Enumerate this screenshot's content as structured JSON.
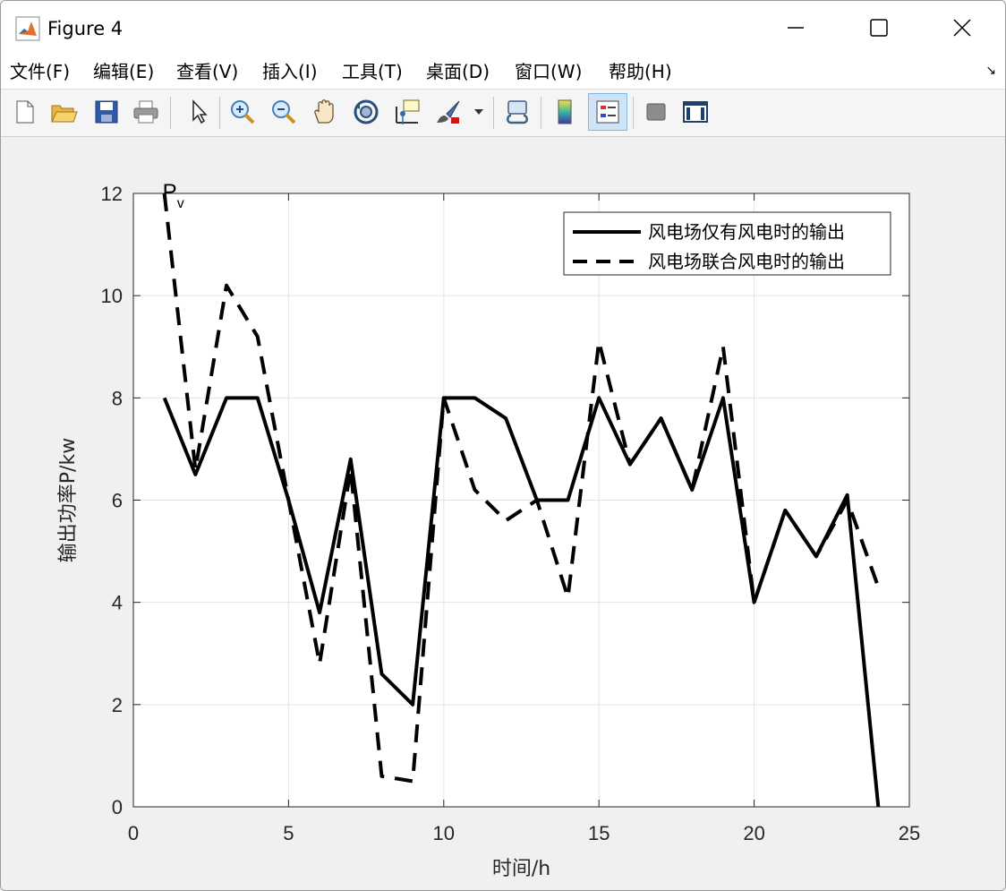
{
  "window": {
    "title": "Figure 4",
    "controls": {
      "minimize_icon": "minimize-icon",
      "maximize_icon": "maximize-icon",
      "close_icon": "close-icon"
    }
  },
  "menubar": {
    "items": [
      "文件(F)",
      "编辑(E)",
      "查看(V)",
      "插入(I)",
      "工具(T)",
      "桌面(D)",
      "窗口(W)",
      "帮助(H)"
    ],
    "more_glyph": "↘"
  },
  "toolbar": {
    "buttons": [
      "new-figure-icon",
      "open-file-icon",
      "save-icon",
      "print-icon",
      "pointer-icon",
      "zoom-in-icon",
      "zoom-out-icon",
      "pan-hand-icon",
      "rotate-3d-icon",
      "data-cursor-icon",
      "brush-icon",
      "link-plot-icon",
      "colorbar-icon",
      "legend-icon",
      "hide-plot-tools-icon",
      "show-plot-tools-icon"
    ]
  },
  "chart_data": {
    "type": "line",
    "title": "",
    "xlabel": "时间/h",
    "ylabel": "输出功率P/kw",
    "xlim": [
      0,
      25
    ],
    "ylim": [
      0,
      12
    ],
    "xticks": [
      0,
      5,
      10,
      15,
      20,
      25
    ],
    "yticks": [
      0,
      2,
      4,
      6,
      8,
      10,
      12
    ],
    "grid": true,
    "legend_position": "top-right",
    "annotation": {
      "text": "P",
      "subscript": "v",
      "x": 1,
      "y": 12
    },
    "series": [
      {
        "name": "风电场仅有风电时的输出",
        "style": "solid",
        "color": "#000000",
        "x": [
          1,
          2,
          3,
          4,
          5,
          6,
          7,
          8,
          9,
          10,
          11,
          12,
          13,
          14,
          15,
          16,
          17,
          18,
          19,
          20,
          21,
          22,
          23,
          24
        ],
        "values": [
          8.0,
          6.5,
          8.0,
          8.0,
          6.0,
          3.8,
          6.8,
          2.6,
          2.0,
          8.0,
          8.0,
          7.6,
          6.0,
          6.0,
          8.0,
          6.7,
          7.6,
          6.2,
          8.0,
          4.0,
          5.8,
          4.9,
          6.1,
          0.0
        ]
      },
      {
        "name": "风电场联合风电时的输出",
        "style": "dashed",
        "color": "#000000",
        "x": [
          1,
          2,
          3,
          4,
          5,
          6,
          7,
          8,
          9,
          10,
          11,
          12,
          13,
          14,
          15,
          16,
          17,
          18,
          19,
          20,
          21,
          22,
          23,
          24
        ],
        "values": [
          12.0,
          6.6,
          10.2,
          9.2,
          6.0,
          2.8,
          6.6,
          0.6,
          0.5,
          8.0,
          6.2,
          5.6,
          6.0,
          4.1,
          9.1,
          6.7,
          7.6,
          6.2,
          9.0,
          4.0,
          5.8,
          4.9,
          6.0,
          4.3
        ]
      }
    ]
  }
}
